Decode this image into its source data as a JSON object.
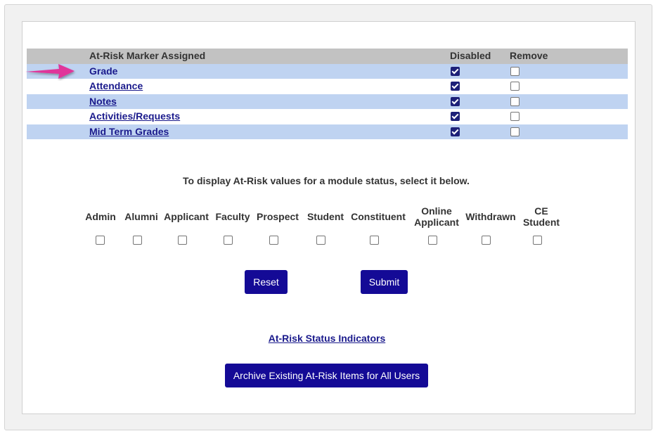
{
  "marker_table": {
    "header": {
      "label": "At-Risk Marker Assigned",
      "disabled": "Disabled",
      "remove": "Remove"
    },
    "rows": [
      {
        "label": "Grade",
        "is_link": false,
        "disabled": true,
        "remove": false
      },
      {
        "label": "Attendance",
        "is_link": true,
        "disabled": true,
        "remove": false
      },
      {
        "label": "Notes",
        "is_link": true,
        "disabled": true,
        "remove": false
      },
      {
        "label": "Activities/Requests",
        "is_link": true,
        "disabled": true,
        "remove": false
      },
      {
        "label": "Mid Term Grades",
        "is_link": true,
        "disabled": true,
        "remove": false
      }
    ]
  },
  "instruction": "To display At-Risk values for a module status, select it below.",
  "statuses": [
    {
      "line1": "Admin",
      "line2": "",
      "checked": false
    },
    {
      "line1": "Alumni",
      "line2": "",
      "checked": false
    },
    {
      "line1": "Applicant",
      "line2": "",
      "checked": false
    },
    {
      "line1": "Faculty",
      "line2": "",
      "checked": false
    },
    {
      "line1": "Prospect",
      "line2": "",
      "checked": false
    },
    {
      "line1": "Student",
      "line2": "",
      "checked": false
    },
    {
      "line1": "Constituent",
      "line2": "",
      "checked": false
    },
    {
      "line1": "Online",
      "line2": "Applicant",
      "checked": false
    },
    {
      "line1": "Withdrawn",
      "line2": "",
      "checked": false
    },
    {
      "line1": "CE",
      "line2": "Student",
      "checked": false
    }
  ],
  "buttons": {
    "reset": "Reset",
    "submit": "Submit",
    "archive": "Archive Existing At-Risk Items for All Users"
  },
  "links": {
    "indicators": "At-Risk Status Indicators"
  },
  "colors": {
    "button": "#140a96",
    "row_alt": "#bfd3f1",
    "header": "#c2c2c2",
    "arrow": "#e0369a",
    "link": "#1a1a8c"
  }
}
